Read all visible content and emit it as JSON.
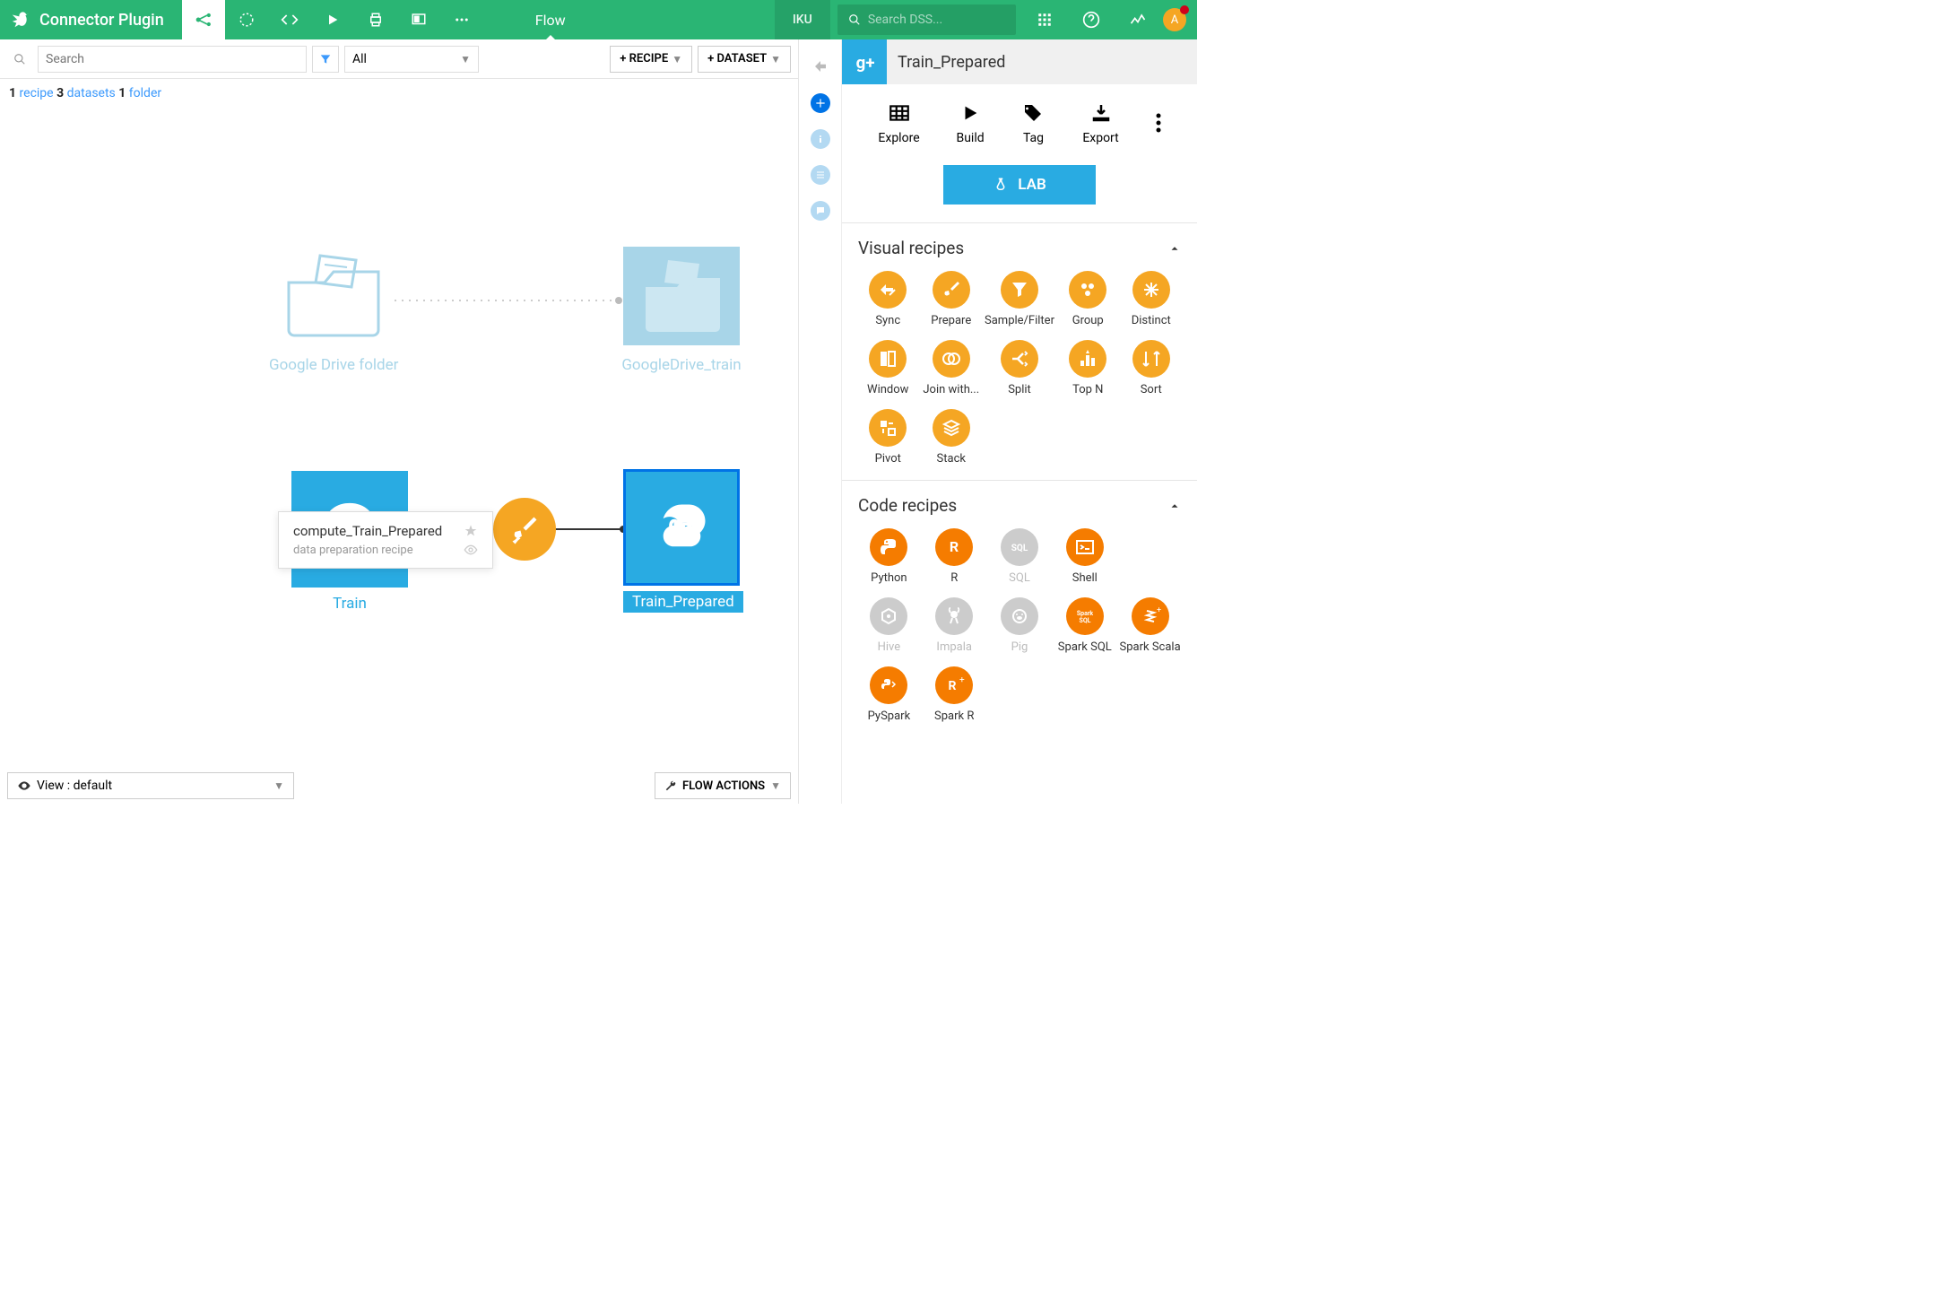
{
  "header": {
    "project_title": "Connector Plugin",
    "active_section": "Flow",
    "workspace": "IKU",
    "search_placeholder": "Search DSS...",
    "avatar_letter": "A"
  },
  "flow_toolbar": {
    "search_placeholder": "Search",
    "filter_all": "All",
    "recipe_btn": "+ RECIPE",
    "dataset_btn": "+ DATASET"
  },
  "counts": {
    "recipe_n": "1",
    "recipe_label": "recipe",
    "datasets_n": "3",
    "datasets_label": "datasets",
    "folder_n": "1",
    "folder_label": "folder"
  },
  "nodes": {
    "folder1": "Google Drive folder",
    "dataset1": "GoogleDrive_train",
    "dataset2": "Train",
    "dataset3": "Train_Prepared",
    "tooltip_title": "compute_Train_Prepared",
    "tooltip_sub": "data preparation recipe"
  },
  "bottom": {
    "view_label": "View : default",
    "flow_actions": "FLOW ACTIONS"
  },
  "panel": {
    "title": "Train_Prepared",
    "actions": {
      "explore": "Explore",
      "build": "Build",
      "tag": "Tag",
      "export": "Export"
    },
    "lab": "LAB",
    "visual_header": "Visual recipes",
    "visual_recipes": [
      "Sync",
      "Prepare",
      "Sample/Filter",
      "Group",
      "Distinct",
      "Window",
      "Join with...",
      "Split",
      "Top N",
      "Sort",
      "Pivot",
      "Stack"
    ],
    "code_header": "Code recipes",
    "code_recipes": [
      {
        "label": "Python",
        "disabled": false
      },
      {
        "label": "R",
        "disabled": false
      },
      {
        "label": "SQL",
        "disabled": true
      },
      {
        "label": "Shell",
        "disabled": false
      },
      {
        "label": "",
        "disabled": true
      },
      {
        "label": "Hive",
        "disabled": true
      },
      {
        "label": "Impala",
        "disabled": true
      },
      {
        "label": "Pig",
        "disabled": true
      },
      {
        "label": "Spark SQL",
        "disabled": false
      },
      {
        "label": "Spark Scala",
        "disabled": false
      },
      {
        "label": "PySpark",
        "disabled": false
      },
      {
        "label": "Spark R",
        "disabled": false
      }
    ]
  }
}
